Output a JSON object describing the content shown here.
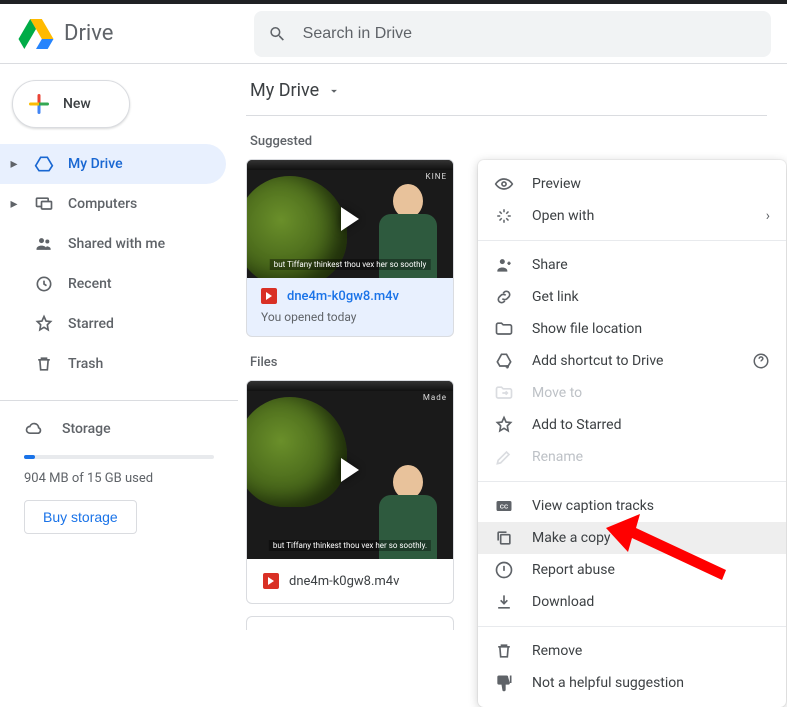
{
  "header": {
    "product": "Drive",
    "search_placeholder": "Search in Drive"
  },
  "sidebar": {
    "new_label": "New",
    "items": [
      {
        "label": "My Drive"
      },
      {
        "label": "Computers"
      },
      {
        "label": "Shared with me"
      },
      {
        "label": "Recent"
      },
      {
        "label": "Starred"
      },
      {
        "label": "Trash"
      }
    ],
    "storage_label": "Storage",
    "usage": "904 MB of 15 GB used",
    "buy_label": "Buy storage"
  },
  "breadcrumb": {
    "title": "My Drive"
  },
  "sections": {
    "suggested": "Suggested",
    "files": "Files"
  },
  "suggested_card": {
    "filename": "dne4m-k0gw8.m4v",
    "subtext": "You opened today",
    "watermark": "KINE",
    "subtitle": "but Tiffany thinkest thou vex her so soothly"
  },
  "file_card": {
    "filename": "dne4m-k0gw8.m4v",
    "watermark": "Made",
    "subtitle": "but Tiffany thinkest thou vex her so soothly."
  },
  "context_menu": {
    "preview": "Preview",
    "open_with": "Open with",
    "share": "Share",
    "get_link": "Get link",
    "show_location": "Show file location",
    "add_shortcut": "Add shortcut to Drive",
    "move_to": "Move to",
    "add_starred": "Add to Starred",
    "rename": "Rename",
    "captions": "View caption tracks",
    "make_copy": "Make a copy",
    "report_abuse": "Report abuse",
    "download": "Download",
    "remove": "Remove",
    "not_helpful": "Not a helpful suggestion"
  }
}
